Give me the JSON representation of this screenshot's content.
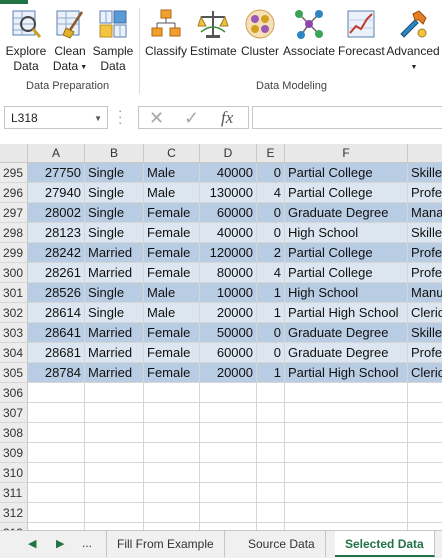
{
  "ribbon": {
    "buttons": [
      {
        "id": "explore",
        "line1": "Explore",
        "line2": "Data",
        "caret": false,
        "icon": "explore-data-icon"
      },
      {
        "id": "clean",
        "line1": "Clean",
        "line2": "Data",
        "caret": true,
        "icon": "clean-data-icon"
      },
      {
        "id": "sample",
        "line1": "Sample",
        "line2": "Data",
        "caret": false,
        "icon": "sample-data-icon"
      },
      {
        "id": "classify",
        "line1": "Classify",
        "line2": "",
        "caret": false,
        "icon": "classify-icon"
      },
      {
        "id": "estimate",
        "line1": "Estimate",
        "line2": "",
        "caret": false,
        "icon": "estimate-icon"
      },
      {
        "id": "cluster",
        "line1": "Cluster",
        "line2": "",
        "caret": false,
        "icon": "cluster-icon"
      },
      {
        "id": "associate",
        "line1": "Associate",
        "line2": "",
        "caret": false,
        "icon": "associate-icon"
      },
      {
        "id": "forecast",
        "line1": "Forecast",
        "line2": "",
        "caret": false,
        "icon": "forecast-icon"
      },
      {
        "id": "advanced",
        "line1": "Advanced",
        "line2": "",
        "caret": true,
        "icon": "advanced-icon"
      }
    ],
    "groups": {
      "data_preparation": "Data Preparation",
      "data_modeling": "Data Modeling"
    }
  },
  "formula_bar": {
    "name_box": "L318",
    "cancel_icon": "✕",
    "enter_icon": "✓",
    "fx_label": "fx",
    "formula": ""
  },
  "grid": {
    "columns": [
      "A",
      "B",
      "C",
      "D",
      "E",
      "F"
    ],
    "rows": [
      {
        "n": "295",
        "a": "27750",
        "b": "Single",
        "c": "Male",
        "d": "40000",
        "e": "0",
        "f": "Partial College",
        "g": "Skille"
      },
      {
        "n": "296",
        "a": "27940",
        "b": "Single",
        "c": "Male",
        "d": "130000",
        "e": "4",
        "f": "Partial College",
        "g": "Profe"
      },
      {
        "n": "297",
        "a": "28002",
        "b": "Single",
        "c": "Female",
        "d": "60000",
        "e": "0",
        "f": "Graduate Degree",
        "g": "Mana"
      },
      {
        "n": "298",
        "a": "28123",
        "b": "Single",
        "c": "Female",
        "d": "40000",
        "e": "0",
        "f": "High School",
        "g": "Skille"
      },
      {
        "n": "299",
        "a": "28242",
        "b": "Married",
        "c": "Female",
        "d": "120000",
        "e": "2",
        "f": "Partial College",
        "g": "Profe"
      },
      {
        "n": "300",
        "a": "28261",
        "b": "Married",
        "c": "Female",
        "d": "80000",
        "e": "4",
        "f": "Partial College",
        "g": "Profe"
      },
      {
        "n": "301",
        "a": "28526",
        "b": "Single",
        "c": "Male",
        "d": "10000",
        "e": "1",
        "f": "High School",
        "g": "Manu"
      },
      {
        "n": "302",
        "a": "28614",
        "b": "Single",
        "c": "Male",
        "d": "20000",
        "e": "1",
        "f": "Partial High School",
        "g": "Cleric"
      },
      {
        "n": "303",
        "a": "28641",
        "b": "Married",
        "c": "Female",
        "d": "50000",
        "e": "0",
        "f": "Graduate Degree",
        "g": "Skille"
      },
      {
        "n": "304",
        "a": "28681",
        "b": "Married",
        "c": "Female",
        "d": "60000",
        "e": "0",
        "f": "Graduate Degree",
        "g": "Profe"
      },
      {
        "n": "305",
        "a": "28784",
        "b": "Married",
        "c": "Female",
        "d": "20000",
        "e": "1",
        "f": "Partial High School",
        "g": "Cleric"
      }
    ],
    "empty_rows": [
      "306",
      "307",
      "308",
      "309",
      "310",
      "311",
      "312",
      "313"
    ]
  },
  "tabs": {
    "nav_prev": "◀",
    "nav_next": "▶",
    "more": "...",
    "items": [
      "Fill From Example",
      "Source Data",
      "Selected Data"
    ],
    "active": "Selected Data"
  },
  "colors": {
    "band_dark": "#b8cce4",
    "band_light": "#dce6f1",
    "accent": "#217346"
  }
}
